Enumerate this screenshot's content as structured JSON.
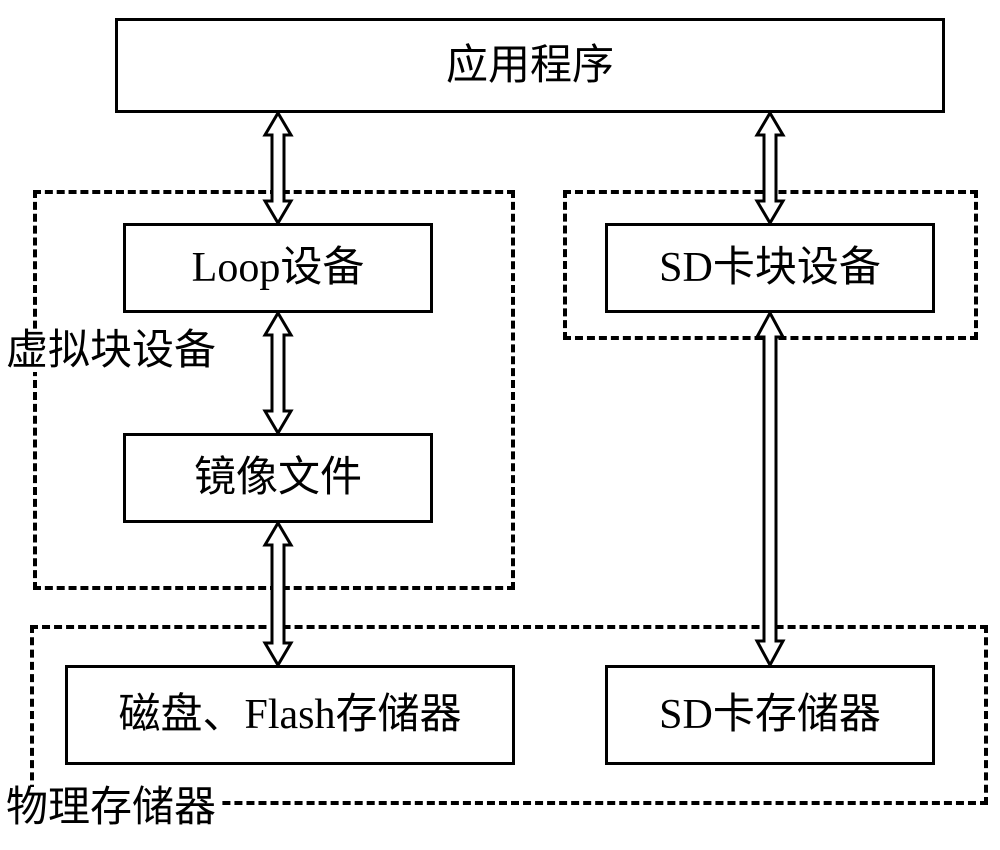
{
  "top": {
    "label": "应用程序"
  },
  "left": {
    "loop": "Loop设备",
    "image": "镜像文件",
    "disk": "磁盘、Flash存储器"
  },
  "right": {
    "sd_block": "SD卡块设备",
    "sd_storage": "SD卡存储器"
  },
  "group_labels": {
    "virtual": "虚拟块设备",
    "physical": "物理存储器"
  }
}
